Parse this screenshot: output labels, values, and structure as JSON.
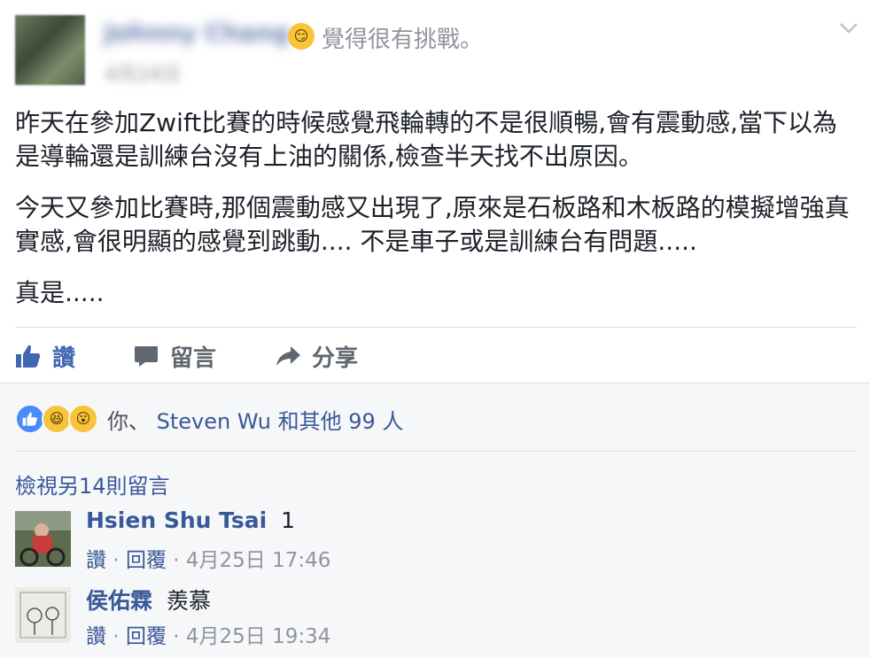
{
  "header": {
    "author_name": "Johnny Chang",
    "feeling_text": "覺得很有挑戰。",
    "timestamp": "4月24日"
  },
  "post": {
    "paragraphs": [
      "昨天在參加Zwift比賽的時候感覺飛輪轉的不是很順暢,會有震動感,當下以為是導輪還是訓練台沒有上油的關係,檢查半天找不出原因。",
      "今天又參加比賽時,那個震動感又出現了,原來是石板路和木板路的模擬增強真實感,會很明顯的感覺到跳動.... 不是車子或是訓練台有問題.....",
      "真是....."
    ]
  },
  "actions": {
    "like": "讚",
    "comment": "留言",
    "share": "分享"
  },
  "reactions": {
    "you": "你、",
    "friend": "Steven Wu",
    "others": "和其他 99 人"
  },
  "view_more": "檢視另14則留言",
  "comments": [
    {
      "name": "Hsien Shu Tsai",
      "text": "1",
      "like": "讚",
      "reply": "回覆",
      "time": "4月25日 17:46"
    },
    {
      "name": "侯佑霖",
      "text": "羨慕",
      "like": "讚",
      "reply": "回覆",
      "time": "4月25日 19:34"
    }
  ],
  "colors": {
    "link": "#385898",
    "like_blue": "#4267b2",
    "secondary": "#90949c"
  }
}
